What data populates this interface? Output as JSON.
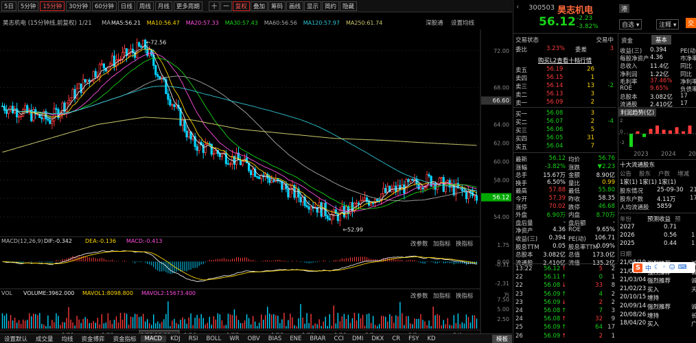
{
  "toolbar": {
    "periods": [
      "5日",
      "5分钟",
      "15分钟",
      "30分钟",
      "60分钟",
      "日线",
      "周线",
      "月线",
      "更多周期"
    ],
    "active_period": "15分钟",
    "tools": [
      "十",
      "一",
      "复权",
      "叠加",
      "筹码",
      "画线",
      "显示",
      "简约",
      "隐藏"
    ],
    "active_tool": "复权"
  },
  "chart": {
    "info_label": "昊志机电 (15分钟线,前复权) 1/21",
    "ma_label": "MA",
    "mas": [
      {
        "label": "MA5:56.21",
        "color": "#e8e8e8"
      },
      {
        "label": "MA10:56.47",
        "color": "#ffd700"
      },
      {
        "label": "MA20:57.33",
        "color": "#ff4fe1"
      },
      {
        "label": "MA30:57.43",
        "color": "#18d418"
      },
      {
        "label": "MA60:56.56",
        "color": "#aaaaaa"
      },
      {
        "label": "MA120:57.97",
        "color": "#2fc7d6"
      },
      {
        "label": "MA250:61.74",
        "color": "#cdc96b"
      }
    ],
    "top_links": [
      "深股通",
      "设置均线"
    ],
    "price_ticks": [
      "72.00",
      "68.00",
      "64.00",
      "62.00",
      "60.00",
      "58.00",
      "56.00",
      "54.00"
    ],
    "current_price_tag": "56.12",
    "highlight_tag": "66.60",
    "high_label": "72.56",
    "low_label": "52.99",
    "macd_label": "MACD(12,26,9)",
    "macd_values": [
      {
        "label": "DIF:-0.342",
        "color": "#e8e8e8"
      },
      {
        "label": "DEA:-0.136",
        "color": "#ffd700"
      },
      {
        "label": "MACD:-0.413",
        "color": "#ff4fe1"
      }
    ],
    "macd_ticks": [
      "1.75",
      "0.00",
      "-0.31",
      "-2.31"
    ],
    "vol_label": "VOL",
    "vol_values": [
      {
        "label": "VOLUME:3962.000",
        "color": "#e8e8e8"
      },
      {
        "label": "MAVOL1:8098.800",
        "color": "#ffd700"
      },
      {
        "label": "MAVOL2:15673.400",
        "color": "#ff4fe1"
      }
    ],
    "vol_ticks": [
      "万",
      "7.50",
      "5.00",
      "2.50"
    ],
    "panel_buttons": [
      "改参数",
      "加指标",
      "换指标"
    ],
    "dates": [
      "1/21",
      "1/22",
      "1/23,10:00",
      "1/26",
      "1/27",
      "1/28",
      "1/29",
      "1/30",
      "2/2",
      "2/3",
      "2/4"
    ],
    "indicator_tabs": [
      "设置默认",
      "成交量",
      "均线",
      "资金博弈",
      "资金指标",
      "MACD",
      "KDJ",
      "RSI",
      "BOLL",
      "WR",
      "OBV",
      "BIAS",
      "ENE",
      "BRAR",
      "CCI",
      "DMI",
      "DKX",
      "CR",
      "FSY",
      "KD"
    ],
    "active_indicator": "MACD",
    "bottom_right_tab": "模板"
  },
  "chart_data": {
    "type": "line",
    "title": "昊志机电 (15分钟线,前复权)",
    "x": [
      "1/21",
      "1/22",
      "1/23",
      "1/26",
      "1/27",
      "1/28",
      "1/29",
      "1/30",
      "2/2",
      "2/3",
      "2/4"
    ],
    "series": [
      {
        "name": "收盘价",
        "values": [
          66.0,
          64.5,
          70.0,
          72.5,
          62.0,
          60.0,
          57.0,
          54.0,
          56.5,
          58.0,
          56.12
        ]
      },
      {
        "name": "MA250",
        "values": [
          61.0,
          62.5,
          64.0,
          64.8,
          64.5,
          63.5,
          63.0,
          62.5,
          62.3,
          62.0,
          61.74
        ]
      }
    ],
    "ylim": [
      52,
      74
    ],
    "annotations": [
      "72.56",
      "52.99"
    ]
  },
  "right": {
    "code": "300503",
    "name": "昊志机电",
    "badge": "港",
    "price": "56.12",
    "change": "-2.23",
    "change_pct": "-3.82%",
    "buttons": [
      "自选",
      "注释",
      "交"
    ],
    "tabs": [
      "资金",
      "基本"
    ],
    "trade_status_label": "交易状态",
    "trade_status": "交易中",
    "weibi_label": "委比",
    "weibi": "3.23%",
    "weicha_label": "委差",
    "weicha": "3",
    "level2_text": "购买L2查看十档行情",
    "asks": [
      {
        "label": "卖五",
        "price": "56.19",
        "vol": "26",
        "chg": ""
      },
      {
        "label": "卖四",
        "price": "56.15",
        "vol": "1",
        "chg": ""
      },
      {
        "label": "卖三",
        "price": "56.14",
        "vol": "13",
        "chg": "-2"
      },
      {
        "label": "卖二",
        "price": "56.13",
        "vol": "3",
        "chg": ""
      },
      {
        "label": "卖一",
        "price": "56.09",
        "vol": "2",
        "chg": ""
      }
    ],
    "bids": [
      {
        "label": "买一",
        "price": "56.08",
        "vol": "3",
        "chg": ""
      },
      {
        "label": "买二",
        "price": "56.07",
        "vol": "2",
        "chg": "-4"
      },
      {
        "label": "买三",
        "price": "56.06",
        "vol": "5",
        "chg": ""
      },
      {
        "label": "买四",
        "price": "56.05",
        "vol": "31",
        "chg": ""
      },
      {
        "label": "买五",
        "price": "56.04",
        "vol": "7",
        "chg": ""
      }
    ],
    "stats": [
      [
        "最新",
        "56.12",
        "均价",
        "56.76"
      ],
      [
        "涨幅",
        "-3.82%",
        "涨跌",
        "▼2.23"
      ],
      [
        "总手",
        "15.67万",
        "金额",
        "8.90亿"
      ],
      [
        "换手",
        "6.50%",
        "量比",
        "0.99"
      ],
      [
        "最高",
        "57.88",
        "最低",
        "55.80"
      ],
      [
        "今开",
        "57.39",
        "昨收",
        "58.35"
      ],
      [
        "涨停",
        "70.02",
        "跌停",
        "46.68"
      ],
      [
        "外盘",
        "6.90万",
        "内盘",
        "8.70万"
      ],
      [
        "盘后量",
        "-",
        "盘后额",
        "-"
      ],
      [
        "净资产",
        "4.36",
        "ROE",
        "9.65%"
      ],
      [
        "收益(三)",
        "0.394",
        "PE(动)",
        "106.71"
      ],
      [
        "股息TTM",
        "0.05",
        "股息率TTM",
        "0.09%"
      ],
      [
        "总股本",
        "3.082亿",
        "总值",
        "173.0亿"
      ],
      [
        "流通股",
        "2.410亿",
        "流值",
        "135.2亿"
      ]
    ],
    "ticks": [
      [
        "13:22",
        "56.12",
        "5",
        "2"
      ],
      [
        "22",
        "56.11",
        "0",
        "1"
      ],
      [
        "22",
        "56.08",
        "33",
        "8"
      ],
      [
        "23",
        "56.09",
        "4",
        "2"
      ],
      [
        "23",
        "56.09",
        "2",
        "2"
      ],
      [
        "24",
        "56.08",
        "7",
        "3"
      ],
      [
        "24",
        "56.08",
        "32",
        "9"
      ],
      [
        "25",
        "56.09",
        "64",
        "17"
      ],
      [
        "26",
        "56.09",
        "2",
        "1"
      ]
    ],
    "fund": {
      "rows": [
        [
          "收益(三)",
          "0.394",
          "PE(动)",
          ""
        ],
        [
          "每股净资产",
          "4.36",
          "市净率",
          ""
        ],
        [
          "总收入",
          "11.4亿",
          "同比",
          ""
        ],
        [
          "净利润",
          "1.22亿",
          "同比",
          ""
        ],
        [
          "毛利率",
          "37.46%",
          "净利率",
          ""
        ],
        [
          "ROE",
          "9.65%",
          "负债率",
          ""
        ],
        [
          "总股本",
          "3.082亿",
          "17",
          ""
        ],
        [
          "流通股",
          "2.410亿",
          "17",
          ""
        ]
      ],
      "profit_title": "利润趋势(亿)",
      "bar_years": [
        "2023",
        "2024",
        "2025"
      ],
      "bar_values": [
        -1.6,
        0.3,
        -0.4,
        0.6,
        1.0,
        0.5,
        0.4,
        0.8,
        0.3,
        1.0
      ],
      "holder_title": "十大流通股东",
      "holder_header": [
        "公告",
        "股东",
        "户数",
        "增减"
      ],
      "holder_row": [
        "1家(1)",
        "1家(1)",
        "1家(1)"
      ],
      "holder_stats": [
        [
          "股东情况",
          "25-09-30",
          "21"
        ],
        [
          "股东户数",
          "4.11万",
          "17"
        ],
        [
          "人均流通股",
          "5859",
          ""
        ]
      ],
      "forecast_tabs": [
        "年份",
        "预测收益",
        "预"
      ],
      "forecast": [
        [
          "2027",
          "0.71",
          ""
        ],
        [
          "2026",
          "0.56",
          "1"
        ],
        [
          "2025",
          "0.44",
          "1"
        ]
      ],
      "rating_header": [
        "日期",
        "",
        ""
      ],
      "ratings": [
        [
          "21/05/19",
          "强烈推荐",
          "诚"
        ],
        [
          "21/03/24",
          "强烈推荐",
          "诚"
        ],
        [
          "21/03/04",
          "强烈推荐",
          "诚"
        ],
        [
          "21/02/23",
          "买入",
          "天"
        ],
        [
          "20/10/15",
          "增持",
          ""
        ],
        [
          "20/09/14",
          "强烈推荐",
          "诚"
        ],
        [
          "20/08/26",
          "增持",
          "长"
        ],
        [
          "18/04/20",
          "买入",
          "广"
        ]
      ],
      "ime": "中"
    }
  }
}
